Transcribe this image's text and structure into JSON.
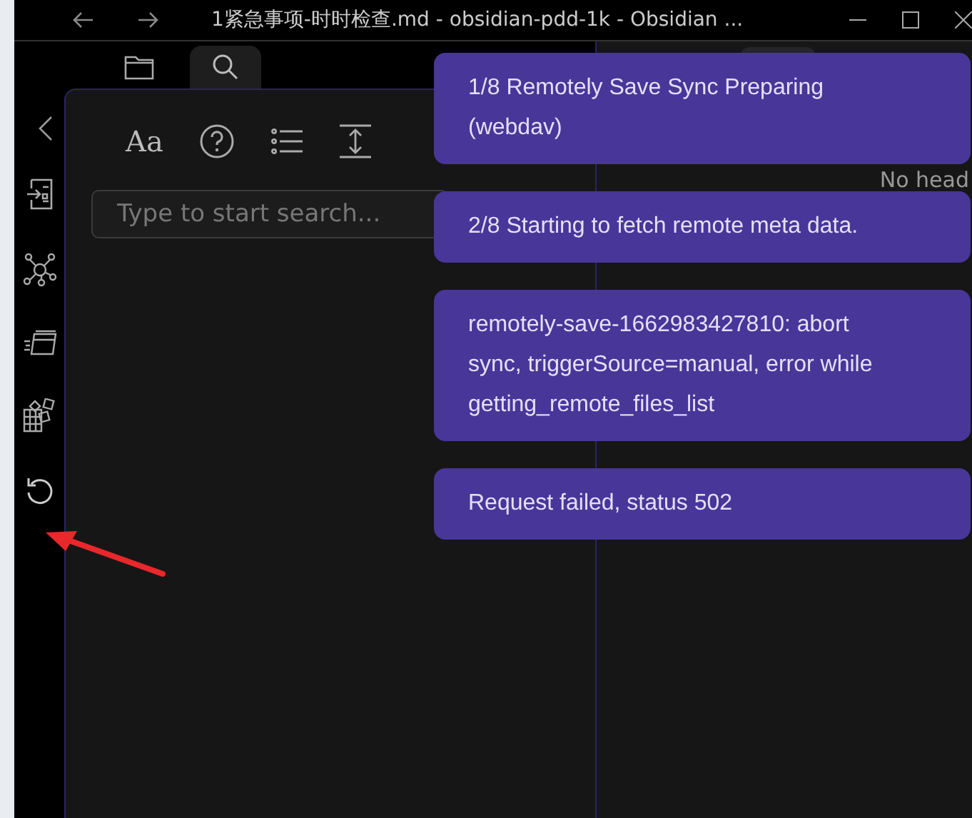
{
  "window": {
    "title": "1紧急事项-时时检查.md - obsidian-pdd-1k - Obsidian ..."
  },
  "left_tabs": [
    {
      "kind": "folder",
      "selected": false
    },
    {
      "kind": "search",
      "selected": true
    }
  ],
  "search_toolbar": {
    "case_label": "Aa"
  },
  "search": {
    "placeholder": "Type to start search..."
  },
  "right_pane": {
    "text": "No head"
  },
  "notices": [
    {
      "text": "1/8 Remotely Save Sync Preparing (webdav)"
    },
    {
      "text": "2/8 Starting to fetch remote meta data."
    },
    {
      "text": "remotely-save-1662983427810: abort sync, triggerSource=manual, error while getting_remote_files_list"
    },
    {
      "text": "Request failed, status 502"
    }
  ]
}
